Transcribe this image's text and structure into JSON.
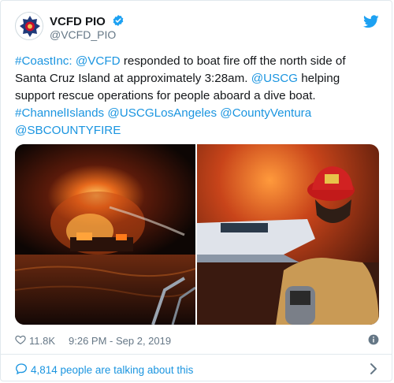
{
  "tweet": {
    "display_name": "VCFD PIO",
    "handle": "@VCFD_PIO",
    "text_parts": [
      {
        "t": "#CoastInc:",
        "link": true
      },
      {
        "t": "  ",
        "link": false
      },
      {
        "t": "@VCFD",
        "link": true
      },
      {
        "t": " responded to boat fire off the north side of Santa Cruz Island at approximately 3:28am. ",
        "link": false
      },
      {
        "t": "@USCG",
        "link": true
      },
      {
        "t": " helping support rescue operations for people aboard a dive boat. ",
        "link": false
      },
      {
        "t": "#ChannelIslands",
        "link": true
      },
      {
        "t": " ",
        "link": false
      },
      {
        "t": "@USCGLosAngeles",
        "link": true
      },
      {
        "t": " ",
        "link": false
      },
      {
        "t": "@CountyVentura",
        "link": true
      },
      {
        "t": " ",
        "link": false
      },
      {
        "t": "@SBCOUNTYFIRE",
        "link": true
      }
    ],
    "likes": "11.8K",
    "timestamp": "9:26 PM - Sep 2, 2019",
    "talking": "4,814 people are talking about this"
  },
  "icons": {
    "avatar": "vcfd-badge-logo",
    "verified": "verified-badge-icon",
    "bird": "twitter-bird-icon",
    "heart": "heart-icon",
    "info": "info-icon",
    "bubble": "speech-bubble-icon",
    "chevron": "chevron-right-icon"
  },
  "colors": {
    "link": "#1b95e0",
    "muted": "#657786",
    "text": "#14171a",
    "border": "#e1e8ed"
  }
}
